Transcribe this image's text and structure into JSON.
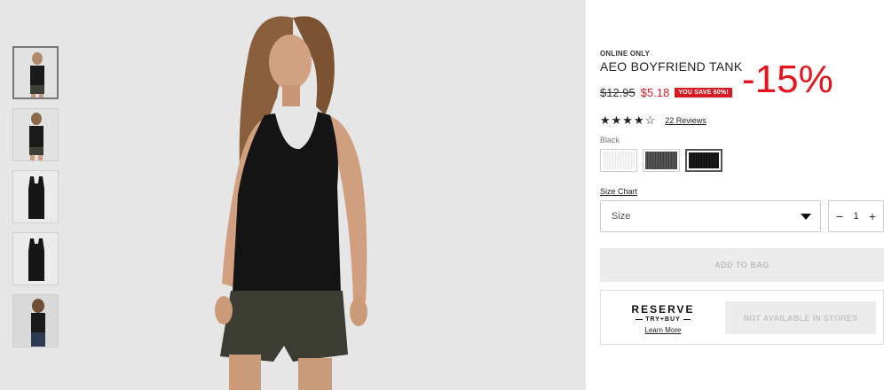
{
  "product": {
    "eyebrow": "ONLINE ONLY",
    "title": "AEO BOYFRIEND TANK",
    "discount_overlay": "-15%",
    "old_price": "$12.95",
    "new_price": "$5.18",
    "save_badge": "YOU SAVE 60%!",
    "rating_stars": "★★★★☆",
    "rating_value": 4,
    "reviews_label": "22 Reviews",
    "color_label": "Black",
    "swatches": [
      {
        "name": "white",
        "color": "#f2f2f2"
      },
      {
        "name": "charcoal",
        "color": "#4a4a4a"
      },
      {
        "name": "black",
        "color": "#151515"
      }
    ],
    "size_chart_label": "Size Chart",
    "size_placeholder": "Size",
    "quantity": "1",
    "qty_minus": "−",
    "qty_plus": "+",
    "add_to_bag": "ADD TO BAG",
    "reserve": {
      "line1": "RESERVE",
      "line2": "TRY+BUY",
      "learn_more": "Learn More",
      "not_available": "NOT AVAILABLE IN STORES"
    }
  },
  "colors": {
    "sale_red": "#d51c24",
    "overlay_red": "#e3141c"
  }
}
